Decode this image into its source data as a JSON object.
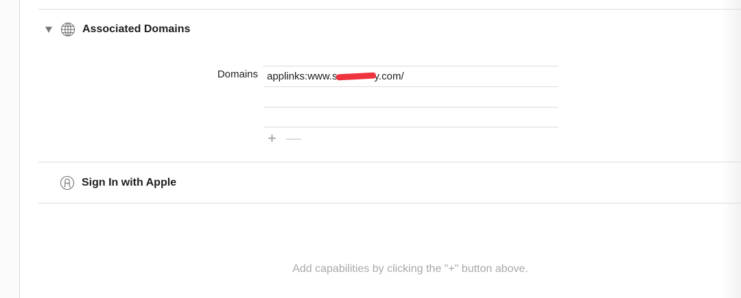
{
  "associated_domains": {
    "title": "Associated Domains",
    "domains_label": "Domains",
    "domains": [
      {
        "prefix": "applinks:www.s",
        "suffix": "y.com/"
      },
      {
        "prefix": "",
        "suffix": ""
      },
      {
        "prefix": "",
        "suffix": ""
      }
    ],
    "add_symbol": "+",
    "remove_symbol": "—"
  },
  "sign_in_with_apple": {
    "title": "Sign In with Apple"
  },
  "hint": "Add capabilities by clicking the \"+\" button above.",
  "colors": {
    "divider": "#dcdcdc",
    "redaction": "#f0343f",
    "hint": "#a8a8a8"
  },
  "icons": {
    "associated_domains": "globe-icon",
    "sign_in_with_apple": "person-icon"
  }
}
